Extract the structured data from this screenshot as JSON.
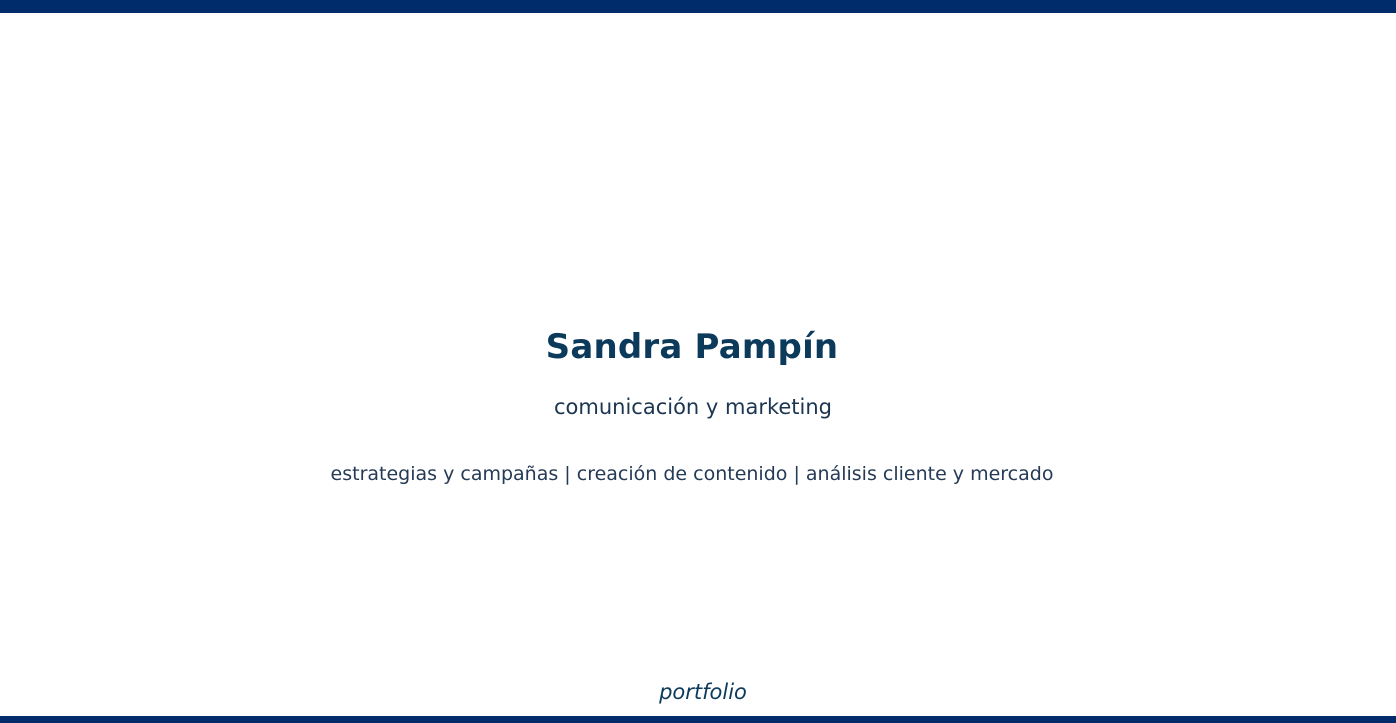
{
  "colors": {
    "brand": "#002c6c",
    "title": "#0c3a5b",
    "text": "#243a55"
  },
  "hero": {
    "name": "Sandra Pampín",
    "role": "comunicación y marketing",
    "services": "estrategias y campañas | creación de contenido | análisis cliente y mercado"
  },
  "footer": {
    "portfolio_label": "portfolio"
  }
}
